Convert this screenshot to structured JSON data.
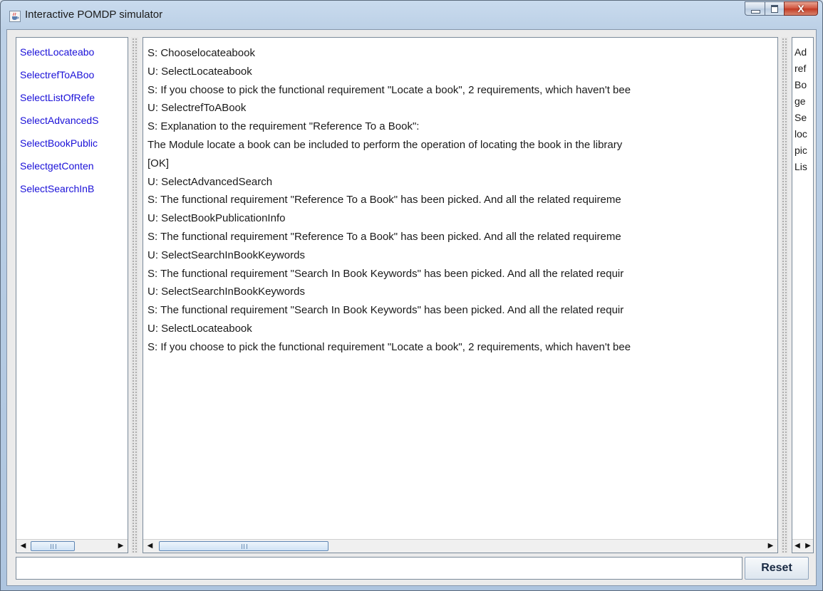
{
  "window": {
    "title": "Interactive POMDP simulator"
  },
  "actions_list": {
    "items": [
      "SelectLocateabo",
      "SelectrefToABoo",
      "SelectListOfRefe",
      "SelectAdvancedS",
      "SelectBookPublic",
      "SelectgetConten",
      "SelectSearchInB"
    ]
  },
  "dialog_log": {
    "lines": [
      "S: Chooselocateabook",
      "U: SelectLocateabook",
      "S: If you choose to pick the functional requirement \"Locate a book\", 2 requirements, which haven't bee",
      "U: SelectrefToABook",
      "S: Explanation to the requirement \"Reference To a Book\":",
      "The Module locate a book can be included to perform the operation of locating the book in the library",
      "[OK]",
      "U: SelectAdvancedSearch",
      "S: The functional requirement \"Reference To a Book\" has been picked. And all the related requireme",
      "U: SelectBookPublicationInfo",
      "S: The functional requirement \"Reference To a Book\" has been picked. And all the related requireme",
      "U: SelectSearchInBookKeywords",
      "S: The functional requirement \"Search In Book Keywords\" has been picked. And all the related requir",
      "U: SelectSearchInBookKeywords",
      "S: The functional requirement \"Search In Book Keywords\" has been picked. And all the related requir",
      "U: SelectLocateabook",
      "S: If you choose to pick the functional requirement \"Locate a book\", 2 requirements, which haven't bee"
    ]
  },
  "side_list": {
    "items": [
      "Ad",
      "ref",
      "Bo",
      "ge",
      "Se",
      "loc",
      "pic",
      "Lis"
    ]
  },
  "input": {
    "value": ""
  },
  "buttons": {
    "reset_label": "Reset"
  },
  "icons": {
    "app": "java-cup-icon",
    "minimize": "minimize-icon",
    "maximize": "maximize-icon",
    "close": "close-icon",
    "scroll_left": "arrow-left-icon",
    "scroll_right": "arrow-right-icon"
  },
  "colors": {
    "link": "#1a10d8",
    "close_button": "#c23a23"
  }
}
